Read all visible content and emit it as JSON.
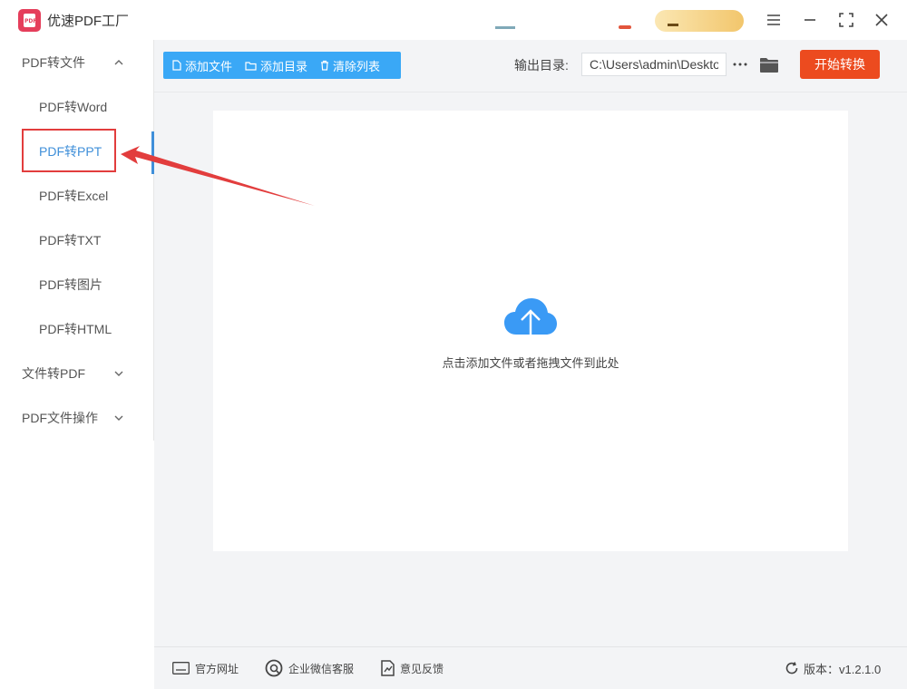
{
  "app": {
    "title": "优速PDF工厂",
    "logo_text": "PDF"
  },
  "sidebar": {
    "groups": [
      {
        "label": "PDF转文件",
        "expanded": true,
        "items": [
          {
            "label": "PDF转Word"
          },
          {
            "label": "PDF转PPT",
            "active": true
          },
          {
            "label": "PDF转Excel"
          },
          {
            "label": "PDF转TXT"
          },
          {
            "label": "PDF转图片"
          },
          {
            "label": "PDF转HTML"
          }
        ]
      },
      {
        "label": "文件转PDF",
        "expanded": false
      },
      {
        "label": "PDF文件操作",
        "expanded": false
      }
    ]
  },
  "toolbar": {
    "add_file": "添加文件",
    "add_folder": "添加目录",
    "clear_list": "清除列表",
    "output_label": "输出目录:",
    "output_path": "C:\\Users\\admin\\Desktop",
    "start": "开始转换"
  },
  "dropzone": {
    "text": "点击添加文件或者拖拽文件到此处"
  },
  "footer": {
    "website": "官方网址",
    "wechat": "企业微信客服",
    "feedback": "意见反馈",
    "version": "版本：v1.2.1.0"
  },
  "colors": {
    "accent": "#3f8fd9",
    "toolbar_blue": "#3aa8f6",
    "start_orange": "#ec4b1f",
    "annotation_red": "#e23d3d",
    "cloud_blue": "#3a9af5"
  }
}
